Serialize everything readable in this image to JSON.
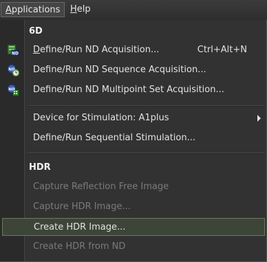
{
  "menubar": {
    "applications_mnemonic": "A",
    "applications_rest": "pplications",
    "help_mnemonic": "H",
    "help_rest": "elp"
  },
  "sections": {
    "six_d": "6D",
    "hdr": "HDR"
  },
  "items": {
    "nd_acquisition": {
      "mnemonic": "D",
      "rest": "efine/Run ND Acquisition...",
      "shortcut": "Ctrl+Alt+N",
      "icon": "nd-acquisition-icon"
    },
    "nd_sequence": {
      "label": "Define/Run ND Sequence Acquisition...",
      "icon": "nd-sequence-icon"
    },
    "nd_multipoint": {
      "label": "Define/Run ND Multipoint Set Acquisition...",
      "icon": "nd-multipoint-icon"
    },
    "device_stimulation": {
      "label": "Device for Stimulation: A1plus"
    },
    "sequential_stimulation": {
      "label": "Define/Run Sequential Stimulation..."
    },
    "capture_reflection": {
      "label": "Capture Reflection Free Image",
      "disabled": true
    },
    "capture_hdr": {
      "label": "Capture HDR Image...",
      "disabled": true
    },
    "create_hdr": {
      "label": "Create HDR Image...",
      "highlighted": true
    },
    "create_hdr_nd": {
      "label": "Create HDR from ND",
      "disabled": true
    }
  },
  "colors": {
    "menu_bg": "#323232",
    "highlight_bg": "#3d4538",
    "highlight_border": "#6b7a5e",
    "text": "#e2e2e2",
    "disabled_text": "#7b7b7b"
  }
}
